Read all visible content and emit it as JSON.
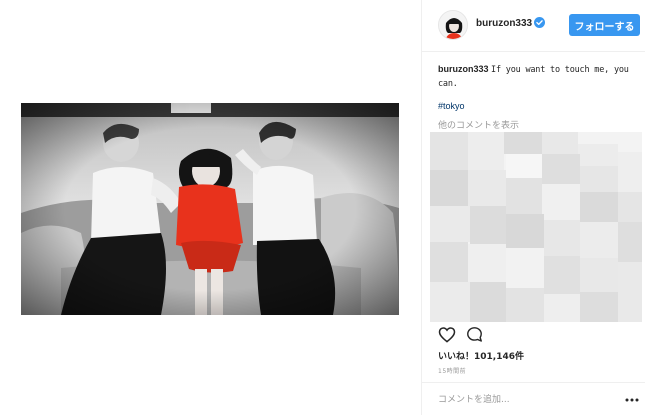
{
  "post": {
    "photo_alt": "",
    "author": {
      "username": "buruzon333",
      "verified": true
    },
    "follow_label": "フォローする",
    "caption": {
      "username": "buruzon333",
      "text": "If you want to touch me, you can."
    },
    "hashtag": "#tokyo",
    "more_comments_label": "他のコメントを表示",
    "likes_text": "いいね！101,146件",
    "timestamp": "15時間前",
    "add_comment_placeholder": "コメントを追加...",
    "icons": {
      "verified": "verified-badge-icon",
      "like": "heart-icon",
      "comment": "comment-bubble-icon",
      "more": "more-options-icon"
    },
    "colors": {
      "follow_button": "#3897f0",
      "verified_badge": "#3897f0",
      "hashtag": "#003569",
      "muted_text": "#999999",
      "dress": "#e8321c"
    }
  }
}
